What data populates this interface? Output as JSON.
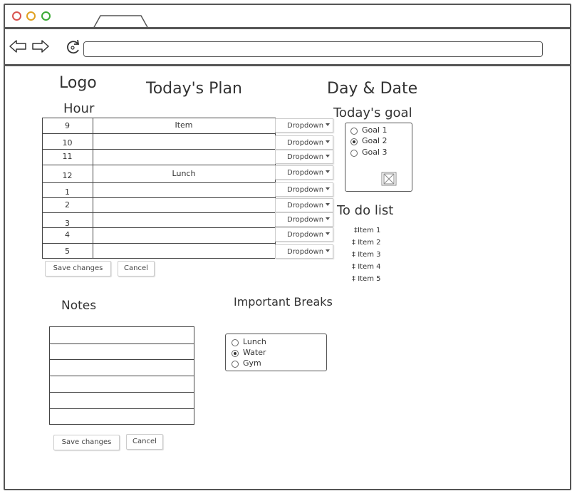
{
  "colors": {
    "dot_red": "#d9534f",
    "dot_yellow": "#e0a020",
    "dot_green": "#3aaa35",
    "stroke": "#555555"
  },
  "browser": {
    "icons": [
      "back-arrow-icon",
      "forward-arrow-icon",
      "refresh-icon"
    ],
    "address_value": ""
  },
  "header": {
    "logo": "Logo",
    "title": "Today's  Plan",
    "date": "Day & Date"
  },
  "schedule": {
    "column_header": "Hour",
    "rows": [
      {
        "hour": "9",
        "item": "Item",
        "dropdown": "Dropdown"
      },
      {
        "hour": "10",
        "item": "",
        "dropdown": "Dropdown"
      },
      {
        "hour": "11",
        "item": "",
        "dropdown": "Dropdown"
      },
      {
        "hour": "12",
        "item": "Lunch",
        "dropdown": "Dropdown"
      },
      {
        "hour": "1",
        "item": "",
        "dropdown": "Dropdown"
      },
      {
        "hour": "2",
        "item": "",
        "dropdown": "Dropdown"
      },
      {
        "hour": "3",
        "item": "",
        "dropdown": "Dropdown"
      },
      {
        "hour": "4",
        "item": "",
        "dropdown": "Dropdown"
      },
      {
        "hour": "5",
        "item": "",
        "dropdown": "Dropdown"
      }
    ],
    "save_label": "Save changes",
    "cancel_label": "Cancel"
  },
  "goals": {
    "title": "Today's goal",
    "options": [
      {
        "label": "Goal 1",
        "selected": false
      },
      {
        "label": "Goal 2",
        "selected": true
      },
      {
        "label": "Goal 3",
        "selected": false
      }
    ],
    "image_icon": "image-placeholder-icon"
  },
  "todo": {
    "title": "To do list",
    "items": [
      "Item 1",
      "Item 2",
      "Item 3",
      "Item 4",
      "Item 5"
    ]
  },
  "notes": {
    "title": "Notes",
    "save_label": "Save changes",
    "cancel_label": "Cancel"
  },
  "breaks": {
    "title": "Important Breaks",
    "options": [
      {
        "label": "Lunch",
        "selected": false
      },
      {
        "label": "Water",
        "selected": true
      },
      {
        "label": "Gym",
        "selected": false
      }
    ]
  }
}
